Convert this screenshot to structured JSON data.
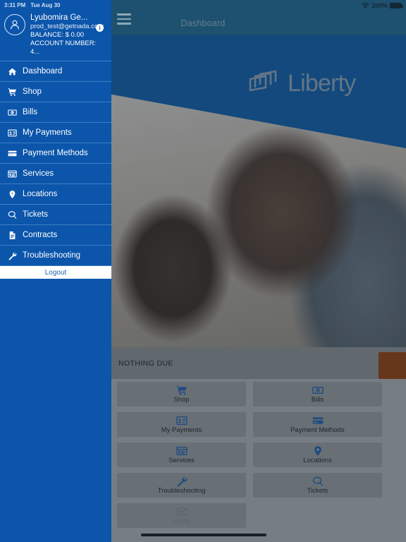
{
  "status_bar": {
    "time": "3:31 PM",
    "date": "Tue Aug 30",
    "wifi_icon": "wifi-icon",
    "battery_percent": "100%",
    "battery_icon": "battery-full-icon"
  },
  "nav": {
    "menu_icon": "hamburger-menu-icon",
    "title": "Dashboard"
  },
  "hero": {
    "logo_text": "Liberty",
    "logo_mark_icon": "liberty-stacked-squares-icon",
    "photo_alt": "mother-and-daughter-laughing-photo"
  },
  "sidebar": {
    "avatar_icon": "user-avatar-icon",
    "info_icon": "info-icon",
    "user_name": "Lyubomira Ge...",
    "user_email": "prod_test@getnada.com",
    "balance": "BALANCE: $ 0.00",
    "account_number": "ACCOUNT NUMBER: 4...",
    "items": [
      {
        "label": "Dashboard",
        "icon": "home-icon"
      },
      {
        "label": "Shop",
        "icon": "shopping-cart-icon"
      },
      {
        "label": "Bills",
        "icon": "banknote-icon"
      },
      {
        "label": "My Payments",
        "icon": "id-card-icon"
      },
      {
        "label": "Payment Methods",
        "icon": "credit-card-icon"
      },
      {
        "label": "Services",
        "icon": "window-panel-icon"
      },
      {
        "label": "Locations",
        "icon": "map-pin-icon"
      },
      {
        "label": "Tickets",
        "icon": "chat-bubble-icon"
      },
      {
        "label": "Contracts",
        "icon": "document-icon"
      },
      {
        "label": "Troubleshooting",
        "icon": "wrench-icon"
      }
    ],
    "logout_label": "Logout"
  },
  "dashboard": {
    "due_status": "NOTHING DUE",
    "pay_button_label": "",
    "pay_button_color": "#9c3d05",
    "accent_blue": "#1f5fae",
    "tiles": [
      {
        "label": "Shop",
        "icon": "shopping-cart-icon",
        "disabled": false
      },
      {
        "label": "Bills",
        "icon": "banknote-icon",
        "disabled": false
      },
      {
        "label": "My Payments",
        "icon": "id-card-icon",
        "disabled": false
      },
      {
        "label": "Payment Methods",
        "icon": "credit-card-icon",
        "disabled": false
      },
      {
        "label": "Services",
        "icon": "window-panel-icon",
        "disabled": false
      },
      {
        "label": "Locations",
        "icon": "map-pin-icon",
        "disabled": false
      },
      {
        "label": "Troubleshooting",
        "icon": "wrench-icon",
        "disabled": false
      },
      {
        "label": "Tickets",
        "icon": "chat-bubble-icon",
        "disabled": false
      },
      {
        "label": "Inbox",
        "icon": "envelope-icon",
        "disabled": true
      }
    ]
  }
}
